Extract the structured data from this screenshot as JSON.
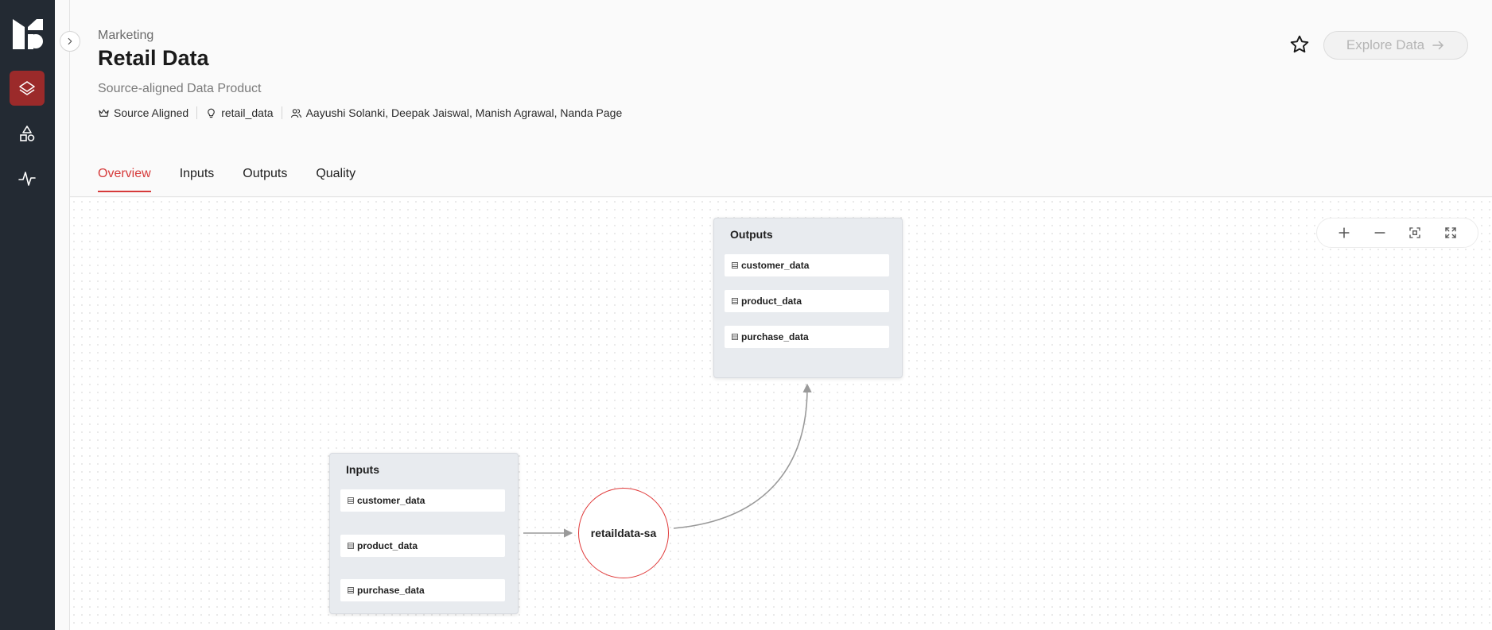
{
  "header": {
    "domain": "Marketing",
    "title": "Retail Data",
    "subtitle": "Source-aligned Data Product",
    "meta": {
      "type": "Source Aligned",
      "namespace": "retail_data",
      "owners": "Aayushi Solanki, Deepak Jaiswal, Manish Agrawal, Nanda Page"
    },
    "explore_label": "Explore Data"
  },
  "tabs": [
    {
      "label": "Overview",
      "active": true
    },
    {
      "label": "Inputs",
      "active": false
    },
    {
      "label": "Outputs",
      "active": false
    },
    {
      "label": "Quality",
      "active": false
    }
  ],
  "graph": {
    "inputs": {
      "title": "Inputs",
      "items": [
        "customer_data",
        "product_data",
        "purchase_data"
      ]
    },
    "center": "retaildata-sa",
    "outputs": {
      "title": "Outputs",
      "items": [
        "customer_data",
        "product_data",
        "purchase_data"
      ]
    }
  },
  "colors": {
    "sidebar": "#232a33",
    "accent": "#d63a3a",
    "active_nav": "#9b2a2a"
  }
}
